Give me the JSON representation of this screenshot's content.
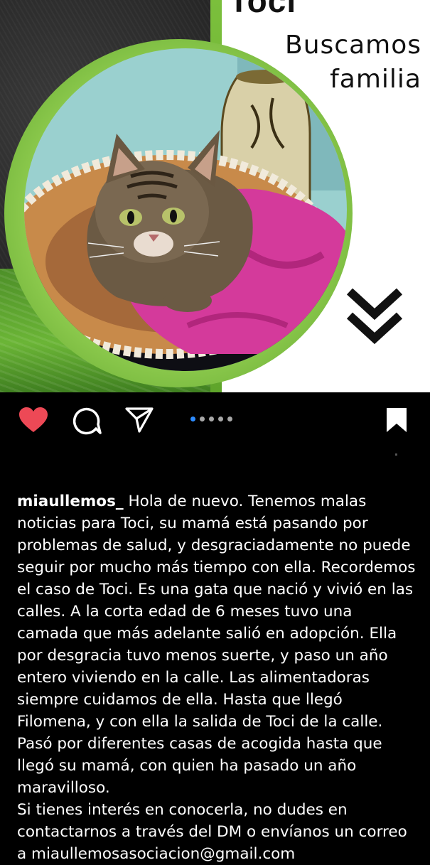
{
  "post": {
    "name_title": "Toci",
    "subtitle_line1": "Buscamos",
    "subtitle_line2": "familia",
    "image_description_icon": "chevron-double-down-icon"
  },
  "actions": {
    "like_icon": "heart-icon",
    "comment_icon": "comment-icon",
    "share_icon": "send-icon",
    "save_icon": "bookmark-icon",
    "like_color": "#ed4956",
    "carousel_total": 5,
    "carousel_active": 1,
    "active_dot_color": "#2d8cff"
  },
  "caption": {
    "username": "miaullemos_",
    "paragraph1": " Hola de nuevo. Tenemos malas noticias para Toci, su mamá está pasando por problemas de salud, y desgraciadamente no puede seguir por mucho más tiempo con ella. Recordemos el caso de Toci. Es una gata que nació y vivió en las calles. A la corta edad de 6 meses tuvo una camada que más adelante salió en adopción. Ella por desgracia tuvo menos suerte, y paso un año entero viviendo en la calle. Las alimentadoras siempre cuidamos de ella. Hasta que llegó Filomena, y con ella la salida de Toci de la calle. Pasó por diferentes casas de acogida hasta que llegó su mamá, con quien ha pasado un año maravilloso.",
    "paragraph2": "Si tienes interés en conocerla, no dudes en contactarnos a través del DM o envíanos un correo a miaullemosasociacion@gmail.com"
  }
}
